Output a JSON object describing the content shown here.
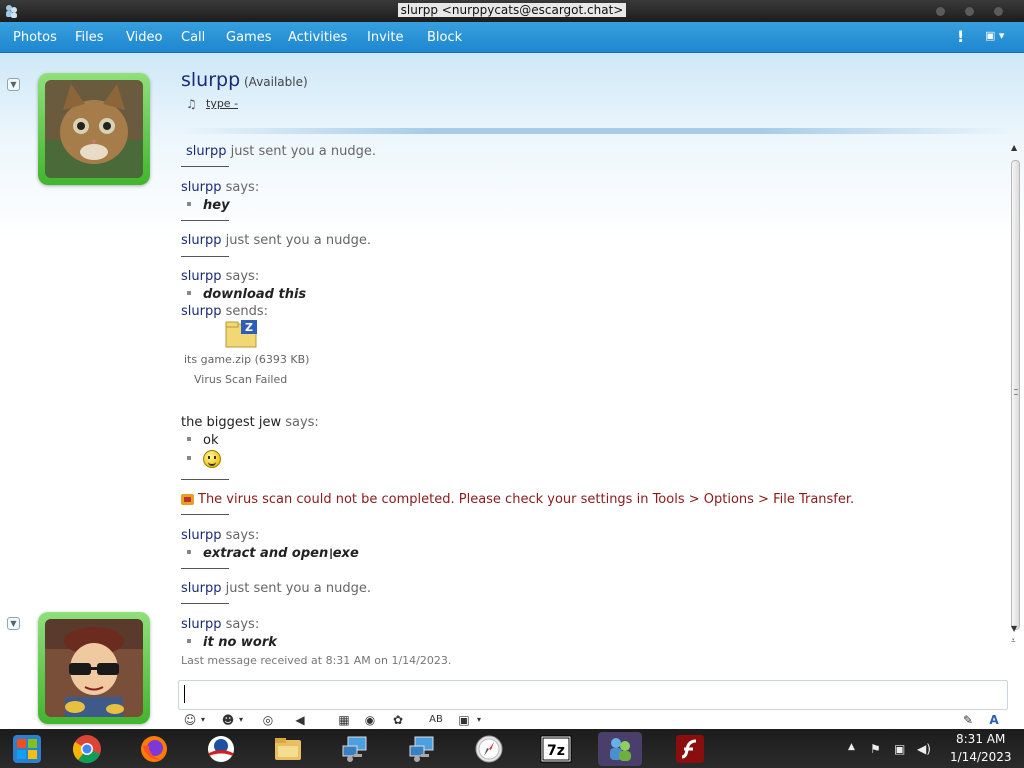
{
  "window": {
    "title": "slurpp <nurppycats@escargot.chat>"
  },
  "menu": [
    "Photos",
    "Files",
    "Video",
    "Call",
    "Games",
    "Activities",
    "Invite",
    "Block"
  ],
  "contact": {
    "name": "slurpp",
    "status": "(Available)",
    "psm": "type -"
  },
  "messages": {
    "nudge1_sender": "slurpp",
    "nudge1_text": "just sent you a nudge.",
    "m1_sender": "slurpp",
    "says": "says:",
    "m1_text": "hey",
    "nudge2_sender": "slurpp",
    "nudge2_text": "just sent you a nudge.",
    "m2_sender": "slurpp",
    "m2_text": "download this",
    "send_sender": "slurpp",
    "sends": "sends:",
    "file_name": "its game.zip (6393 KB)",
    "file_status": "Virus Scan Failed",
    "m3_sender": "the biggest jew",
    "m3_text": "ok",
    "warning": "The virus scan could not be completed. Please check your settings in Tools > Options > File Transfer.",
    "m4_sender": "slurpp",
    "m4_text": "extract and open exe",
    "nudge3_sender": "slurpp",
    "nudge3_text": "just sent you a nudge.",
    "m5_sender": "slurpp",
    "m5_text": "it no work"
  },
  "footer": {
    "last_message": "Last message received at 8:31 AM on 1/14/2023."
  },
  "clock": {
    "time": "8:31 AM",
    "date": "1/14/2023"
  },
  "colors": {
    "menubar": "#1e87cf",
    "name": "#1b2a78",
    "warning": "#8b1a1a",
    "avatar_frame": "#41b52d"
  }
}
